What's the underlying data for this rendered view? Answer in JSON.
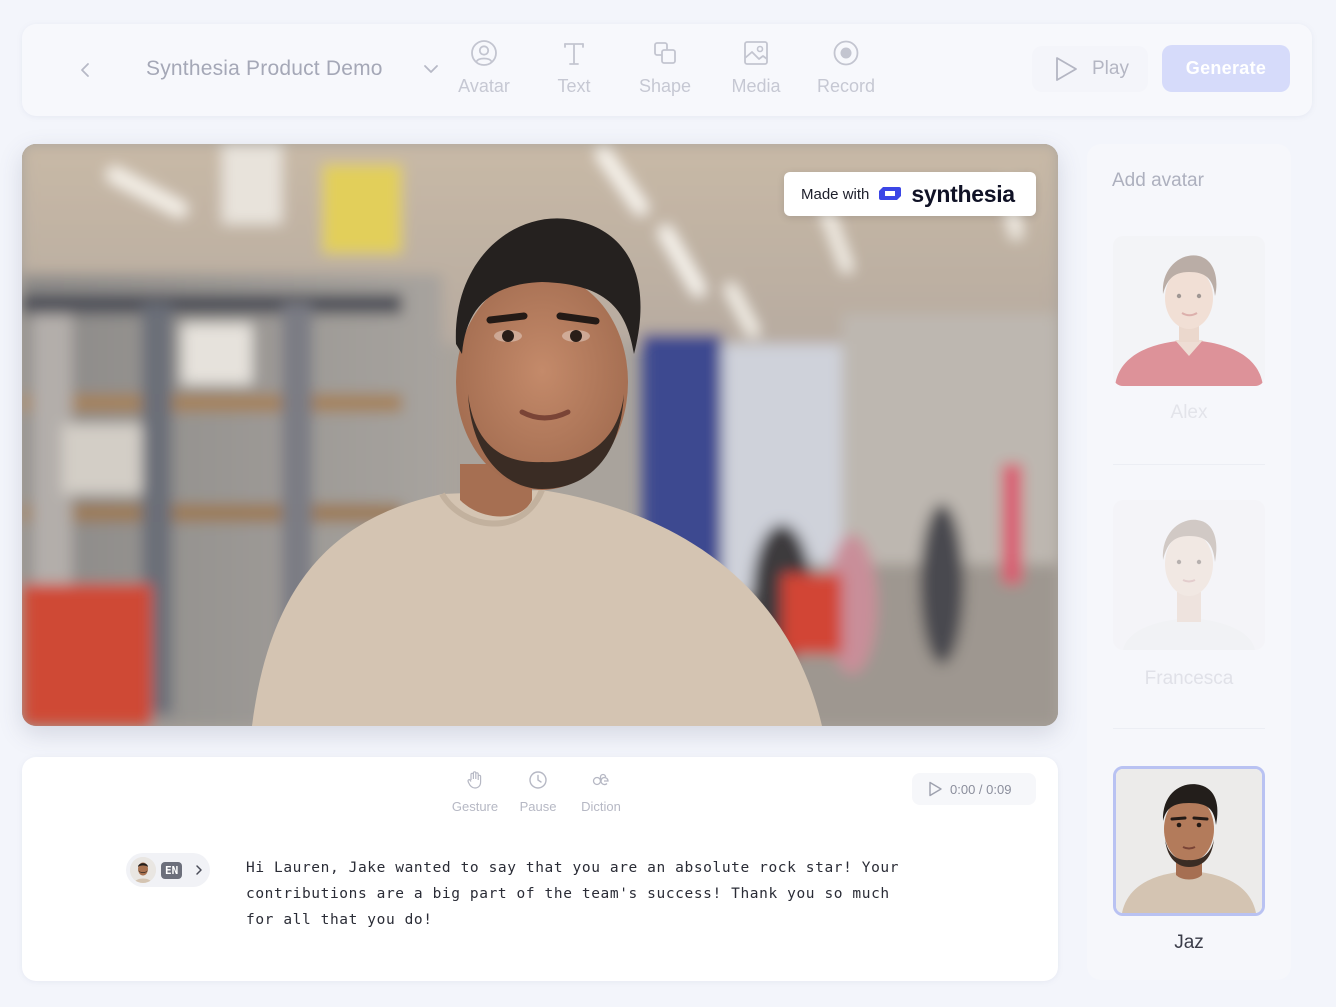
{
  "toolbar": {
    "project_title": "Synthesia Product Demo",
    "tools": [
      {
        "label": "Avatar",
        "icon": "avatar-icon"
      },
      {
        "label": "Text",
        "icon": "text-icon"
      },
      {
        "label": "Shape",
        "icon": "shape-icon"
      },
      {
        "label": "Media",
        "icon": "media-icon"
      },
      {
        "label": "Record",
        "icon": "record-icon"
      }
    ],
    "play_label": "Play",
    "generate_label": "Generate"
  },
  "canvas": {
    "badge_prefix": "Made with",
    "badge_brand": "synthesia",
    "brand_color": "#3b46e6"
  },
  "script": {
    "tools": [
      {
        "label": "Gesture",
        "icon": "hand-icon"
      },
      {
        "label": "Pause",
        "icon": "clock-icon"
      },
      {
        "label": "Diction",
        "icon": "diction-icon"
      }
    ],
    "timer": "0:00 / 0:09",
    "language": "EN",
    "text": "Hi Lauren, Jake wanted to say that you are an absolute rock star! Your contributions are a big part of the team's success! Thank you so much for all that you do!"
  },
  "avatars": {
    "heading": "Add avatar",
    "items": [
      {
        "name": "Alex",
        "selected": false
      },
      {
        "name": "Francesca",
        "selected": false
      },
      {
        "name": "Jaz",
        "selected": true
      }
    ]
  },
  "colors": {
    "accent": "#b9c2f2",
    "generate_bg": "#d6dbfa",
    "page_bg": "#f3f5fb"
  }
}
